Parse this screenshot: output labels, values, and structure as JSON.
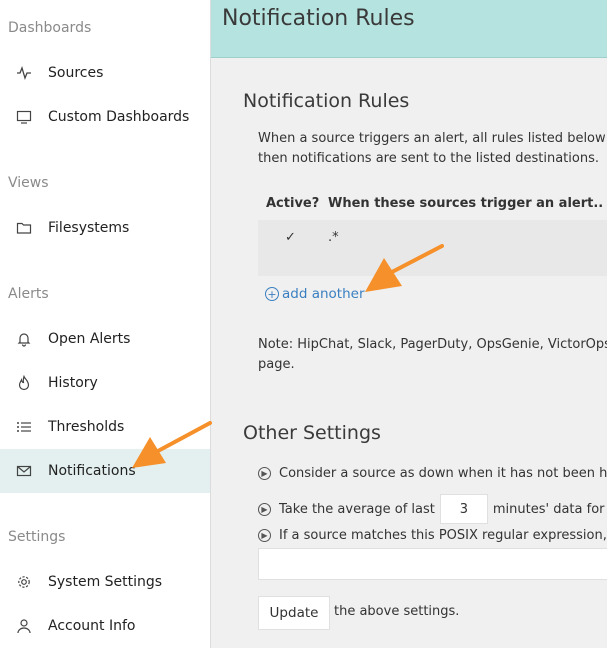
{
  "sidebar": {
    "sections": [
      {
        "title": "Dashboards",
        "items": [
          {
            "label": "Sources",
            "icon": "activity-icon"
          },
          {
            "label": "Custom Dashboards",
            "icon": "monitor-icon"
          }
        ]
      },
      {
        "title": "Views",
        "items": [
          {
            "label": "Filesystems",
            "icon": "folder-icon"
          }
        ]
      },
      {
        "title": "Alerts",
        "items": [
          {
            "label": "Open Alerts",
            "icon": "bell-icon"
          },
          {
            "label": "History",
            "icon": "flame-icon"
          },
          {
            "label": "Thresholds",
            "icon": "list-icon"
          },
          {
            "label": "Notifications",
            "icon": "mail-icon",
            "active": true
          }
        ]
      },
      {
        "title": "Settings",
        "items": [
          {
            "label": "System Settings",
            "icon": "gear-icon"
          },
          {
            "label": "Account Info",
            "icon": "user-icon"
          }
        ]
      }
    ]
  },
  "header": {
    "title": "Notification Rules"
  },
  "rules": {
    "title": "Notification Rules",
    "description_line1": "When a source triggers an alert, all rules listed below are",
    "description_line2": "then notifications are sent to the listed destinations.",
    "columns": [
      "Active?",
      "When these sources trigger an alert.."
    ],
    "rows": [
      {
        "active": "✓",
        "pattern": ".*"
      }
    ],
    "add_label": "add another",
    "note_line1": "Note: HipChat, Slack, PagerDuty, OpsGenie, VictorOps an",
    "note_line2": "page."
  },
  "other": {
    "title": "Other Settings",
    "setting1": "Consider a source as down when it has not been hear",
    "setting2_before": "Take the average of last",
    "setting2_value": "3",
    "setting2_after": "minutes' data for ch",
    "setting3": "If a source matches this POSIX regular expression, do",
    "update_label": "Update",
    "after_update": "the above settings."
  },
  "colors": {
    "accent_header": "#b5e3df",
    "active_item": "#e3f0ef",
    "link": "#3a7fc1",
    "arrow": "#f5902a"
  }
}
